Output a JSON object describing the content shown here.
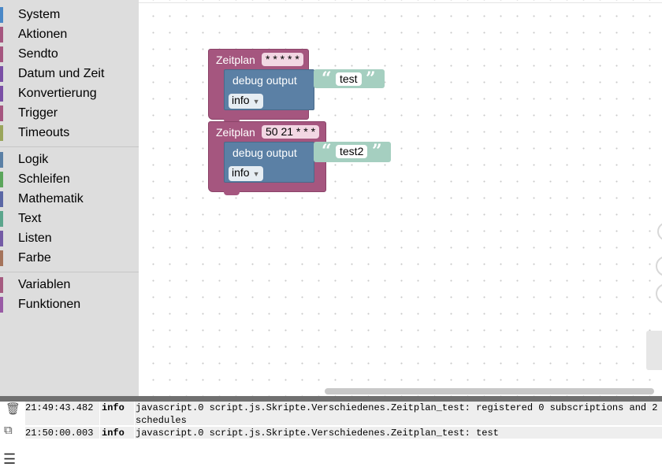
{
  "toolbox": {
    "groups": [
      [
        {
          "label": "System",
          "color": "#4a88c7"
        },
        {
          "label": "Aktionen",
          "color": "#a5567f"
        },
        {
          "label": "Sendto",
          "color": "#a5567f"
        },
        {
          "label": "Datum und Zeit",
          "color": "#7a4fa5"
        },
        {
          "label": "Konvertierung",
          "color": "#7a4fa5"
        },
        {
          "label": "Trigger",
          "color": "#a5567f"
        },
        {
          "label": "Timeouts",
          "color": "#9aa55b"
        }
      ],
      [
        {
          "label": "Logik",
          "color": "#5b80a5"
        },
        {
          "label": "Schleifen",
          "color": "#5ba55b"
        },
        {
          "label": "Mathematik",
          "color": "#5b67a5"
        },
        {
          "label": "Text",
          "color": "#5ba58c"
        },
        {
          "label": "Listen",
          "color": "#745ba5"
        },
        {
          "label": "Farbe",
          "color": "#a5745b"
        }
      ],
      [
        {
          "label": "Variablen",
          "color": "#a55b80"
        },
        {
          "label": "Funktionen",
          "color": "#995ba5"
        }
      ]
    ]
  },
  "blocks": {
    "schedule1": {
      "label": "Zeitplan",
      "cron": "* * * * *",
      "debug_label": "debug output",
      "string": "test",
      "level": "info"
    },
    "schedule2": {
      "label": "Zeitplan",
      "cron": "50 21 * * *",
      "debug_label": "debug output",
      "string": "test2",
      "level": "info"
    },
    "quote_open": "“",
    "quote_close": "”"
  },
  "log": {
    "rows": [
      {
        "time": "21:49:43.482",
        "level": "info",
        "message": "javascript.0 script.js.Skripte.Verschiedenes.Zeitplan_test: registered 0 subscriptions and 2\nschedules"
      },
      {
        "time": "21:50:00.003",
        "level": "info",
        "message": "javascript.0 script.js.Skripte.Verschiedenes.Zeitplan_test: test"
      }
    ]
  },
  "icons": {
    "clear": "trash-small-icon",
    "copy": "copy-icon",
    "toggle": "log-toggle-icon"
  }
}
